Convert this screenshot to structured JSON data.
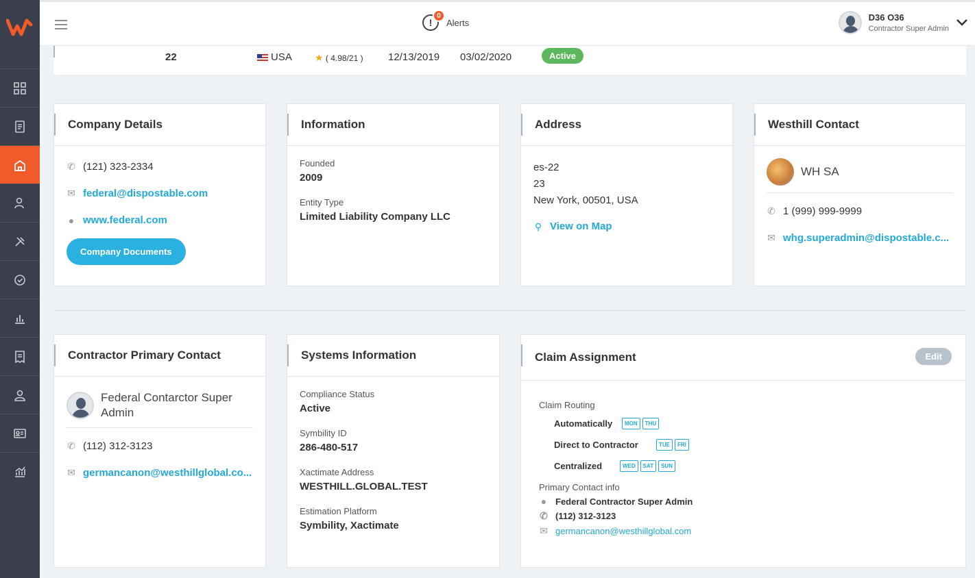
{
  "topbar": {
    "alerts_label": "Alerts",
    "alerts_count": "0",
    "user_name": "D36 O36",
    "user_role": "Contractor Super Admin"
  },
  "strip": {
    "number": "22",
    "country": "USA",
    "rating": "( 4.98/21 )",
    "date1": "12/13/2019",
    "date2": "03/02/2020",
    "status": "Active"
  },
  "company_details": {
    "title": "Company Details",
    "phone": "(121) 323-2334",
    "email": "federal@dispostable.com",
    "website": "www.federal.com",
    "docs_button": "Company Documents"
  },
  "information": {
    "title": "Information",
    "founded_label": "Founded",
    "founded_value": "2009",
    "entity_label": "Entity Type",
    "entity_value": "Limited Liability Company LLC"
  },
  "address": {
    "title": "Address",
    "line1": "es-22",
    "line2": "23",
    "line3": "New York, 00501, USA",
    "map_link": "View on Map"
  },
  "westhill_contact": {
    "title": "Westhill Contact",
    "name": "WH SA",
    "phone": "1 (999) 999-9999",
    "email": "whg.superadmin@dispostable.c..."
  },
  "primary_contact": {
    "title": "Contractor Primary Contact",
    "name": "Federal Contarctor Super Admin",
    "phone": "(112) 312-3123",
    "email": "germancanon@westhillglobal.co..."
  },
  "systems_info": {
    "title": "Systems Information",
    "compliance_label": "Compliance Status",
    "compliance_value": "Active",
    "symbility_label": "Symbility ID",
    "symbility_value": "286-480-517",
    "xactimate_label": "Xactimate Address",
    "xactimate_value": "WESTHILL.GLOBAL.TEST",
    "platform_label": "Estimation Platform",
    "platform_value": "Symbility, Xactimate"
  },
  "claim_assignment": {
    "title": "Claim Assignment",
    "edit_button": "Edit",
    "routing_label": "Claim Routing",
    "routes": [
      {
        "name": "Automatically",
        "days": [
          "MON",
          "THU"
        ]
      },
      {
        "name": "Direct to Contractor",
        "days": [
          "TUE",
          "FRI"
        ]
      },
      {
        "name": "Centralized",
        "days": [
          "WED",
          "SAT",
          "SUN"
        ]
      }
    ],
    "primary_label": "Primary Contact info",
    "primary_name": "Federal Contractor Super Admin",
    "primary_phone": "(112) 312-3123",
    "primary_email": "germancanon@westhillglobal.com"
  },
  "colors": {
    "accent": "#f15a29",
    "link": "#22a9d9",
    "sidebar": "#3a3f4b",
    "status_active": "#5cb85c"
  }
}
